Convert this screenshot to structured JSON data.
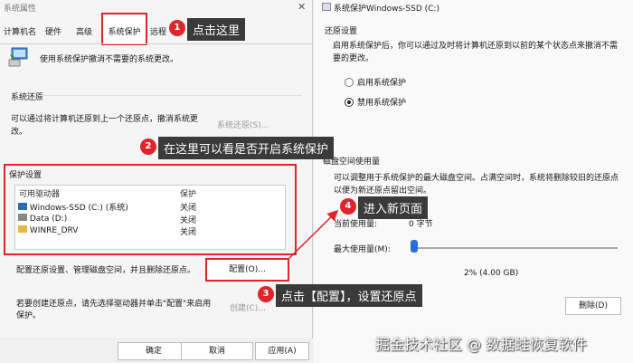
{
  "left_dialog": {
    "title": "系统属性",
    "tabs": [
      "计算机名",
      "硬件",
      "高级",
      "系统保护",
      "远程"
    ],
    "protect_desc": "使用系统保护撤消不需要的系统更改。",
    "restore_section": {
      "title": "系统还原",
      "desc": "可以通过将计算机还原到上一个还原点，撤消系统更改。",
      "button": "系统还原(S)..."
    },
    "protect_settings": {
      "title": "保护设置",
      "headers": [
        "可用驱动器",
        "保护"
      ],
      "drives": [
        {
          "name": "Windows-SSD (C:) (系统)",
          "status": "关闭"
        },
        {
          "name": "Data (D:)",
          "status": "关闭"
        },
        {
          "name": "WINRE_DRV",
          "status": "关闭"
        }
      ],
      "configure_desc": "配置还原设置、管理磁盘空间，并且删除还原点。",
      "configure_button": "配置(O)...",
      "create_desc": "若要创建还原点，请先选择驱动器并单击\"配置\"来启用保护。",
      "create_button": "创建(C)..."
    },
    "buttons": {
      "ok": "确定",
      "cancel": "取消",
      "apply": "应用(A)"
    }
  },
  "right_dialog": {
    "title": "系统保护Windows-SSD (C:)",
    "restore_title": "还原设置",
    "restore_desc": "启用系统保护后，你可以通过及时将计算机还原到以前的某个状态点来撤消不需要的更改。",
    "options": [
      {
        "label": "启用系统保护",
        "checked": false
      },
      {
        "label": "禁用系统保护",
        "checked": true
      }
    ],
    "disk_title": "磁盘空间使用量",
    "disk_desc": "可以调整用于系统保护的最大磁盘空间。占满空间时，系统将删除较旧的还原点以便为新还原点留出空间。",
    "current_label": "当前使用量:",
    "current_value": "0 字节",
    "max_label": "最大使用量(M):",
    "max_value": "2% (4.00 GB)",
    "slider_percent": 2,
    "delete_button": "删除(D)"
  },
  "callouts": [
    {
      "num": "1",
      "text": "点击这里"
    },
    {
      "num": "2",
      "text": "在这里可以看是否开启系统保护"
    },
    {
      "num": "3",
      "text": "点击【配置】，设置还原点"
    },
    {
      "num": "4",
      "text": "进入新页面"
    }
  ],
  "watermark": "掘金技术社区 @ 数据蛙恢复软件",
  "colors": {
    "accent": "#e0242b",
    "callout_bg": "#3a3a3a",
    "slider": "#2b6fd6"
  }
}
